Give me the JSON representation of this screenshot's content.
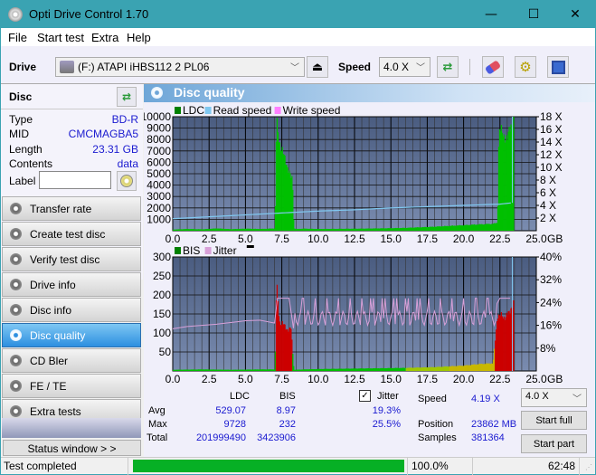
{
  "window": {
    "title": "Opti Drive Control 1.70",
    "minimize": "—",
    "maximize": "☐",
    "close": "✕"
  },
  "menu": [
    "File",
    "Start test",
    "Extra",
    "Help"
  ],
  "toolbar": {
    "drive_label": "Drive",
    "drive_value": "(F:)  ATAPI iHBS112  2 PL06",
    "speed_label": "Speed",
    "speed_value": "4.0 X"
  },
  "disc": {
    "header": "Disc",
    "fields": [
      {
        "key": "Type",
        "value": "BD-R"
      },
      {
        "key": "MID",
        "value": "CMCMAGBA5"
      },
      {
        "key": "Length",
        "value": "23.31 GB"
      },
      {
        "key": "Contents",
        "value": "data"
      }
    ],
    "label_key": "Label",
    "label_value": ""
  },
  "nav": [
    {
      "label": "Transfer rate",
      "active": false
    },
    {
      "label": "Create test disc",
      "active": false
    },
    {
      "label": "Verify test disc",
      "active": false
    },
    {
      "label": "Drive info",
      "active": false
    },
    {
      "label": "Disc info",
      "active": false
    },
    {
      "label": "Disc quality",
      "active": true
    },
    {
      "label": "CD Bler",
      "active": false
    },
    {
      "label": "FE / TE",
      "active": false
    },
    {
      "label": "Extra tests",
      "active": false
    }
  ],
  "status_window_label": "Status window > >",
  "panel_title": "Disc quality",
  "colors": {
    "ldc": "#00c000",
    "read_speed": "#80c8f0",
    "write_speed": "#ff80ff",
    "bis": "#cc0000",
    "jitter": "#d8a0d8",
    "plot_bg_top": "#4a5c80",
    "plot_bg_bottom": "#7a8cb0"
  },
  "chart_data": [
    {
      "type": "bar",
      "title": "LDC / Read speed",
      "legend": [
        "LDC",
        "Read speed",
        "Write speed"
      ],
      "legend_placement": "top-left",
      "xlabel": "GB",
      "xlim": [
        0,
        25
      ],
      "x_ticks": [
        "0.0",
        "2.5",
        "5.0",
        "7.5",
        "10.0",
        "12.5",
        "15.0",
        "17.5",
        "20.0",
        "22.5",
        "25.0"
      ],
      "ylim_left": [
        0,
        10000
      ],
      "y_ticks_left": [
        "1000",
        "2000",
        "3000",
        "4000",
        "5000",
        "6000",
        "7000",
        "8000",
        "9000",
        "10000"
      ],
      "ylim_right": [
        0,
        18
      ],
      "y_ticks_right": [
        "2 X",
        "4 X",
        "6 X",
        "8 X",
        "10 X",
        "12 X",
        "14 X",
        "16 X",
        "18 X"
      ],
      "grid": true,
      "series": [
        {
          "name": "LDC",
          "x": [
            0,
            1,
            2,
            3,
            4,
            5,
            6,
            7,
            7.1,
            7.2,
            7.3,
            7.4,
            7.5,
            7.6,
            7.7,
            7.8,
            7.9,
            8.0,
            8.1,
            8.2,
            8.3,
            8.5,
            9,
            10,
            11,
            12,
            13,
            14,
            15,
            16,
            17,
            18,
            19,
            20,
            21,
            22,
            22.3,
            22.4,
            22.6,
            22.8,
            23.0,
            23.2,
            23.3,
            23.4
          ],
          "values": [
            100,
            150,
            120,
            200,
            130,
            180,
            150,
            200,
            9728,
            8500,
            7800,
            7400,
            7000,
            6500,
            6200,
            5900,
            5500,
            5000,
            4600,
            4500,
            200,
            150,
            180,
            150,
            160,
            170,
            180,
            200,
            220,
            250,
            300,
            350,
            420,
            480,
            550,
            600,
            700,
            9000,
            8500,
            8300,
            8000,
            9300,
            9500,
            9700
          ]
        },
        {
          "name": "Read speed",
          "x": [
            0,
            2.5,
            5,
            7.5,
            10,
            12.5,
            15,
            17.5,
            20,
            22.5,
            23.3
          ],
          "values": [
            1.9,
            2.2,
            2.5,
            2.8,
            3.1,
            3.3,
            3.6,
            3.8,
            4.0,
            4.2,
            4.4
          ]
        }
      ]
    },
    {
      "type": "bar",
      "title": "BIS / Jitter",
      "legend": [
        "BIS",
        "Jitter"
      ],
      "legend_placement": "top-left",
      "xlabel": "GB",
      "xlim": [
        0,
        25
      ],
      "x_ticks": [
        "0.0",
        "2.5",
        "5.0",
        "7.5",
        "10.0",
        "12.5",
        "15.0",
        "17.5",
        "20.0",
        "22.5",
        "25.0"
      ],
      "ylim_left": [
        0,
        300
      ],
      "y_ticks_left": [
        "50",
        "100",
        "150",
        "200",
        "250",
        "300"
      ],
      "ylim_right": [
        0,
        40
      ],
      "y_ticks_right": [
        "8%",
        "16%",
        "24%",
        "32%",
        "40%"
      ],
      "grid": true,
      "series": [
        {
          "name": "BIS",
          "x": [
            0,
            2,
            4,
            6,
            7,
            7.1,
            7.3,
            7.5,
            7.7,
            7.9,
            8.1,
            8.3,
            9,
            10,
            12,
            14,
            16,
            18,
            19,
            20,
            21,
            22,
            22.3,
            22.5,
            22.7,
            22.9,
            23.1,
            23.3,
            23.4
          ],
          "values": [
            3,
            4,
            3,
            4,
            4,
            232,
            130,
            125,
            115,
            110,
            110,
            3,
            4,
            5,
            6,
            7,
            8,
            10,
            12,
            14,
            18,
            20,
            150,
            145,
            140,
            148,
            150,
            175,
            180
          ]
        },
        {
          "name": "Jitter",
          "x": [
            0,
            1,
            2,
            3,
            4,
            5,
            6,
            7,
            7.2,
            7.5,
            8,
            8.3,
            9,
            10,
            12,
            14,
            16,
            18,
            20,
            22,
            22.5,
            23.3
          ],
          "values": [
            14.8,
            15.6,
            16.0,
            16.4,
            17.0,
            17.6,
            17.8,
            16.8,
            25.5,
            25.5,
            25.5,
            15,
            18,
            20,
            19.5,
            20,
            19.5,
            20,
            19.5,
            21,
            25.5,
            25.5
          ]
        }
      ]
    }
  ],
  "stats": {
    "col_ldc": "LDC",
    "col_bis": "BIS",
    "jitter_label": "Jitter",
    "jitter_checked": true,
    "rows": [
      {
        "label": "Avg",
        "ldc": "529.07",
        "bis": "8.97",
        "jitter": "19.3%"
      },
      {
        "label": "Max",
        "ldc": "9728",
        "bis": "232",
        "jitter": "25.5%"
      },
      {
        "label": "Total",
        "ldc": "201999490",
        "bis": "3423906",
        "jitter": ""
      }
    ],
    "speed_label": "Speed",
    "speed_value": "4.19 X",
    "position_label": "Position",
    "position_value": "23862 MB",
    "samples_label": "Samples",
    "samples_value": "381364",
    "speed_select": "4.0 X",
    "start_full": "Start full",
    "start_part": "Start part"
  },
  "statusbar": {
    "text": "Test completed",
    "progress_percent": 100.0,
    "progress_text": "100.0%",
    "time": "62:48"
  }
}
